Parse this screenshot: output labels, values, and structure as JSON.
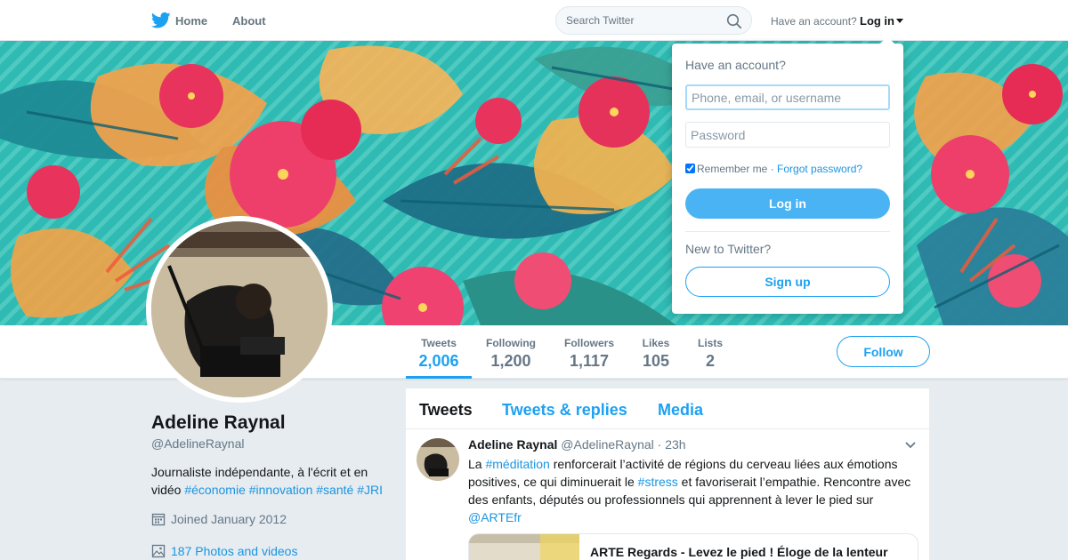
{
  "nav": {
    "home_label": "Home",
    "about_label": "About",
    "search_placeholder": "Search Twitter",
    "have_account_text": "Have an account?",
    "login_label": "Log in"
  },
  "profile": {
    "name": "Adeline Raynal",
    "handle": "@AdelineRaynal",
    "bio_text": "Journaliste indépendante, à l'écrit et en vidéo",
    "bio_hashtags": [
      "#économie",
      "#innovation",
      "#santé",
      "#JRI"
    ],
    "joined": "Joined January 2012",
    "photos": "187 Photos and videos",
    "follow_label": "Follow"
  },
  "stats": [
    {
      "label": "Tweets",
      "value": "2,006",
      "active": true
    },
    {
      "label": "Following",
      "value": "1,200",
      "active": false
    },
    {
      "label": "Followers",
      "value": "1,117",
      "active": false
    },
    {
      "label": "Likes",
      "value": "105",
      "active": false
    },
    {
      "label": "Lists",
      "value": "2",
      "active": false
    }
  ],
  "timeline": {
    "tabs": [
      "Tweets",
      "Tweets & replies",
      "Media"
    ],
    "tweet": {
      "name": "Adeline Raynal",
      "handle": "@AdelineRaynal",
      "dot": "·",
      "time": "23h",
      "text_1": "La ",
      "link_1": "#méditation",
      "text_2": " renforcerait l’activité de régions du cerveau liées aux émotions positives, ce qui diminuerait le ",
      "link_2": "#stress",
      "text_3": " et favoriserait l’empathie. Rencontre avec des enfants, députés ou professionnels qui apprennent à lever le pied sur ",
      "link_3": "@ARTEfr",
      "card_title": "ARTE Regards - Levez le pied ! Éloge de la lenteur"
    }
  },
  "login_dropdown": {
    "title": "Have an account?",
    "username_placeholder": "Phone, email, or username",
    "password_placeholder": "Password",
    "remember_label": "Remember me",
    "separator": " · ",
    "forgot_label": "Forgot password?",
    "login_button": "Log in",
    "new_text": "New to Twitter?",
    "signup_button": "Sign up"
  },
  "colors": {
    "accent": "#1da1f2",
    "login_button_bg": "#4ab3f4",
    "page_bg": "#e6ecf0"
  },
  "icons": [
    "twitter-bird-icon",
    "search-icon",
    "caret-down-icon",
    "calendar-icon",
    "photos-icon",
    "chevron-down-icon"
  ]
}
